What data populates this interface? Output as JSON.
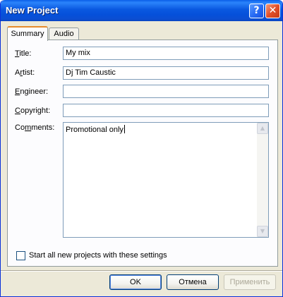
{
  "window": {
    "title": "New Project",
    "help_glyph": "?",
    "close_glyph": "✕",
    "accent": "#0a58e0"
  },
  "tabs": [
    {
      "label": "Summary",
      "selected": true
    },
    {
      "label": "Audio",
      "selected": false
    }
  ],
  "form": {
    "title": {
      "label": "Title:",
      "mnemonic": "T",
      "value": "My mix"
    },
    "artist": {
      "label": "Artist:",
      "mnemonic": "r",
      "value": "Dj Tim Caustic"
    },
    "engineer": {
      "label": "Engineer:",
      "mnemonic": "E",
      "value": ""
    },
    "copyright": {
      "label": "Copyright:",
      "mnemonic": "C",
      "value": ""
    },
    "comments": {
      "label": "Comments:",
      "mnemonic": "m",
      "value": "Promotional only"
    }
  },
  "checkbox": {
    "label": "Start all new projects with these settings",
    "checked": false
  },
  "buttons": {
    "ok": "OK",
    "cancel": "Отмена",
    "apply": "Применить"
  },
  "scroll": {
    "up_glyph": "▲",
    "down_glyph": "▼"
  }
}
